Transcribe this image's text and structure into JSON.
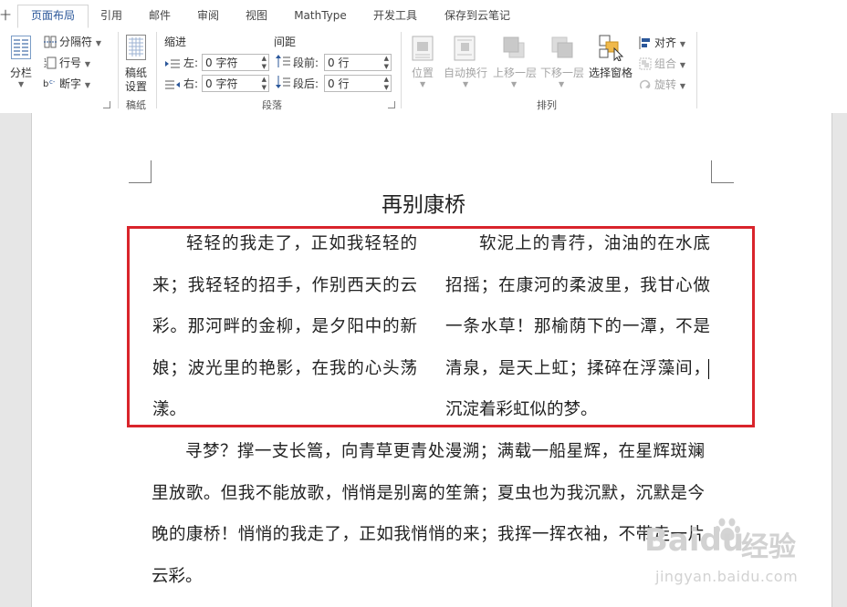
{
  "tabs": [
    "页面布局",
    "引用",
    "邮件",
    "审阅",
    "视图",
    "MathType",
    "开发工具",
    "保存到云笔记"
  ],
  "active_tab_index": 0,
  "ribbon": {
    "columns_label": "分栏",
    "breaks_label": "分隔符",
    "line_numbers_label": "行号",
    "hyphenation_label": "断字",
    "manuscript_settings_line1": "稿纸",
    "manuscript_settings_line2": "设置",
    "group_manuscript": "稿纸",
    "indent_header": "缩进",
    "spacing_header": "间距",
    "indent_left_label": "左:",
    "indent_left_value": "0 字符",
    "indent_right_label": "右:",
    "indent_right_value": "0 字符",
    "spacing_before_label": "段前:",
    "spacing_before_value": "0 行",
    "spacing_after_label": "段后:",
    "spacing_after_value": "0 行",
    "group_paragraph": "段落",
    "position_label": "位置",
    "wrap_text_label": "自动换行",
    "bring_forward_label": "上移一层",
    "send_backward_label": "下移一层",
    "selection_pane_label": "选择窗格",
    "align_label": "对齐",
    "group_label_btn": "组合",
    "rotate_label": "旋转",
    "group_arrange": "排列"
  },
  "document": {
    "title": "再别康桥",
    "column_left": "轻轻的我走了，正如我轻轻的来；我轻轻的招手，作别西天的云彩。那河畔的金柳，是夕阳中的新娘；波光里的艳影，在我的心头荡漾。",
    "column_right": "软泥上的青荇，油油的在水底招摇；在康河的柔波里，我甘心做一条水草！那榆荫下的一潭，不是清泉，是天上虹；揉碎在浮藻间，沉淀着彩虹似的梦。",
    "paragraph": "寻梦？撑一支长篙，向青草更青处漫溯；满载一船星辉，在星辉斑斓里放歌。但我不能放歌，悄悄是别离的笙箫；夏虫也为我沉默，沉默是今晚的康桥！悄悄的我走了，正如我悄悄的来；我挥一挥衣袖，不带走一片云彩。"
  },
  "watermark": {
    "brand": "Baidu",
    "cn": "经验",
    "url": "jingyan.baidu.com"
  },
  "colors": {
    "accent": "#2b579a",
    "highlight": "#d9242b"
  }
}
